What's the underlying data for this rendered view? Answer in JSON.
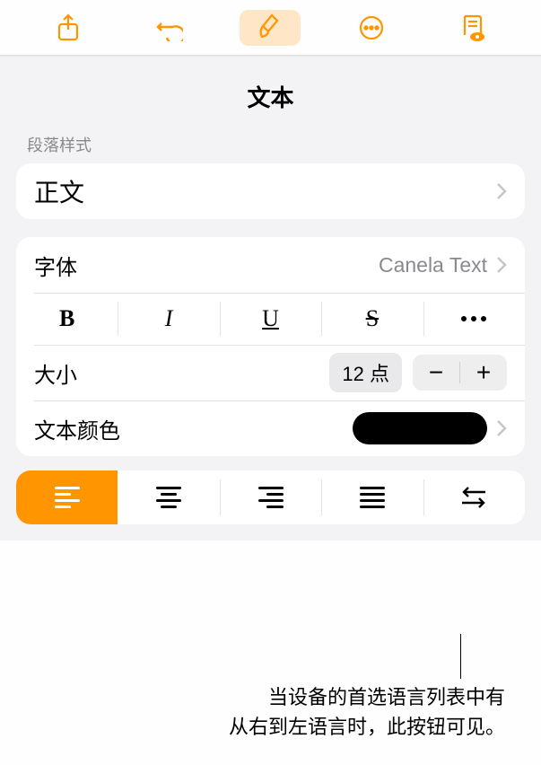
{
  "panel": {
    "title": "文本",
    "paragraph_section_label": "段落样式",
    "paragraph_style_value": "正文",
    "font_label": "字体",
    "font_value": "Canela Text",
    "size_label": "大小",
    "size_value": "12 点",
    "text_color_label": "文本颜色",
    "text_color_value": "#000000"
  },
  "format_buttons": {
    "bold": "B",
    "italic": "I",
    "underline": "U",
    "strike": "S"
  },
  "callout": {
    "line1": "当设备的首选语言列表中有",
    "line2": "从右到左语言时，此按钮可见。"
  },
  "colors": {
    "accent": "#ff9500"
  }
}
